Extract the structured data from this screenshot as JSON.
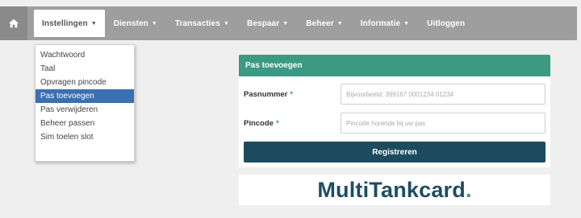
{
  "navbar": {
    "home_icon": "home-icon",
    "items": [
      {
        "label": "Instellingen",
        "has_caret": true,
        "active": true
      },
      {
        "label": "Diensten",
        "has_caret": true
      },
      {
        "label": "Transacties",
        "has_caret": true
      },
      {
        "label": "Bespaar",
        "has_caret": true
      },
      {
        "label": "Beheer",
        "has_caret": true
      },
      {
        "label": "Informatie",
        "has_caret": true
      },
      {
        "label": "Uitloggen",
        "has_caret": false
      }
    ],
    "caret": "▼"
  },
  "dropdown": {
    "items": [
      {
        "label": "Wachtwoord"
      },
      {
        "label": "Taal"
      },
      {
        "label": "Opvragen pincode"
      },
      {
        "label": "Pas toevoegen",
        "selected": true
      },
      {
        "label": "Pas verwijderen"
      },
      {
        "label": "Beheer passen"
      },
      {
        "label": "Sim toelen slot"
      }
    ]
  },
  "panel": {
    "heading": "Pas toevoegen",
    "fields": [
      {
        "label": "Pasnummer",
        "required_mark": "*",
        "placeholder": "Bijvoorbeeld: 399167 0001234 01234"
      },
      {
        "label": "Pincode",
        "required_mark": "*",
        "placeholder": "Pincode horende bij uw pas"
      }
    ],
    "submit_label": "Registreren"
  },
  "logo": {
    "part1": "MultiTankcard",
    "part2": "."
  },
  "colors": {
    "navbar_bg": "#9e9e9e",
    "panel_heading": "#3c9a82",
    "submit_bg": "#1d4b5e",
    "selected_item": "#3b6fb0"
  }
}
